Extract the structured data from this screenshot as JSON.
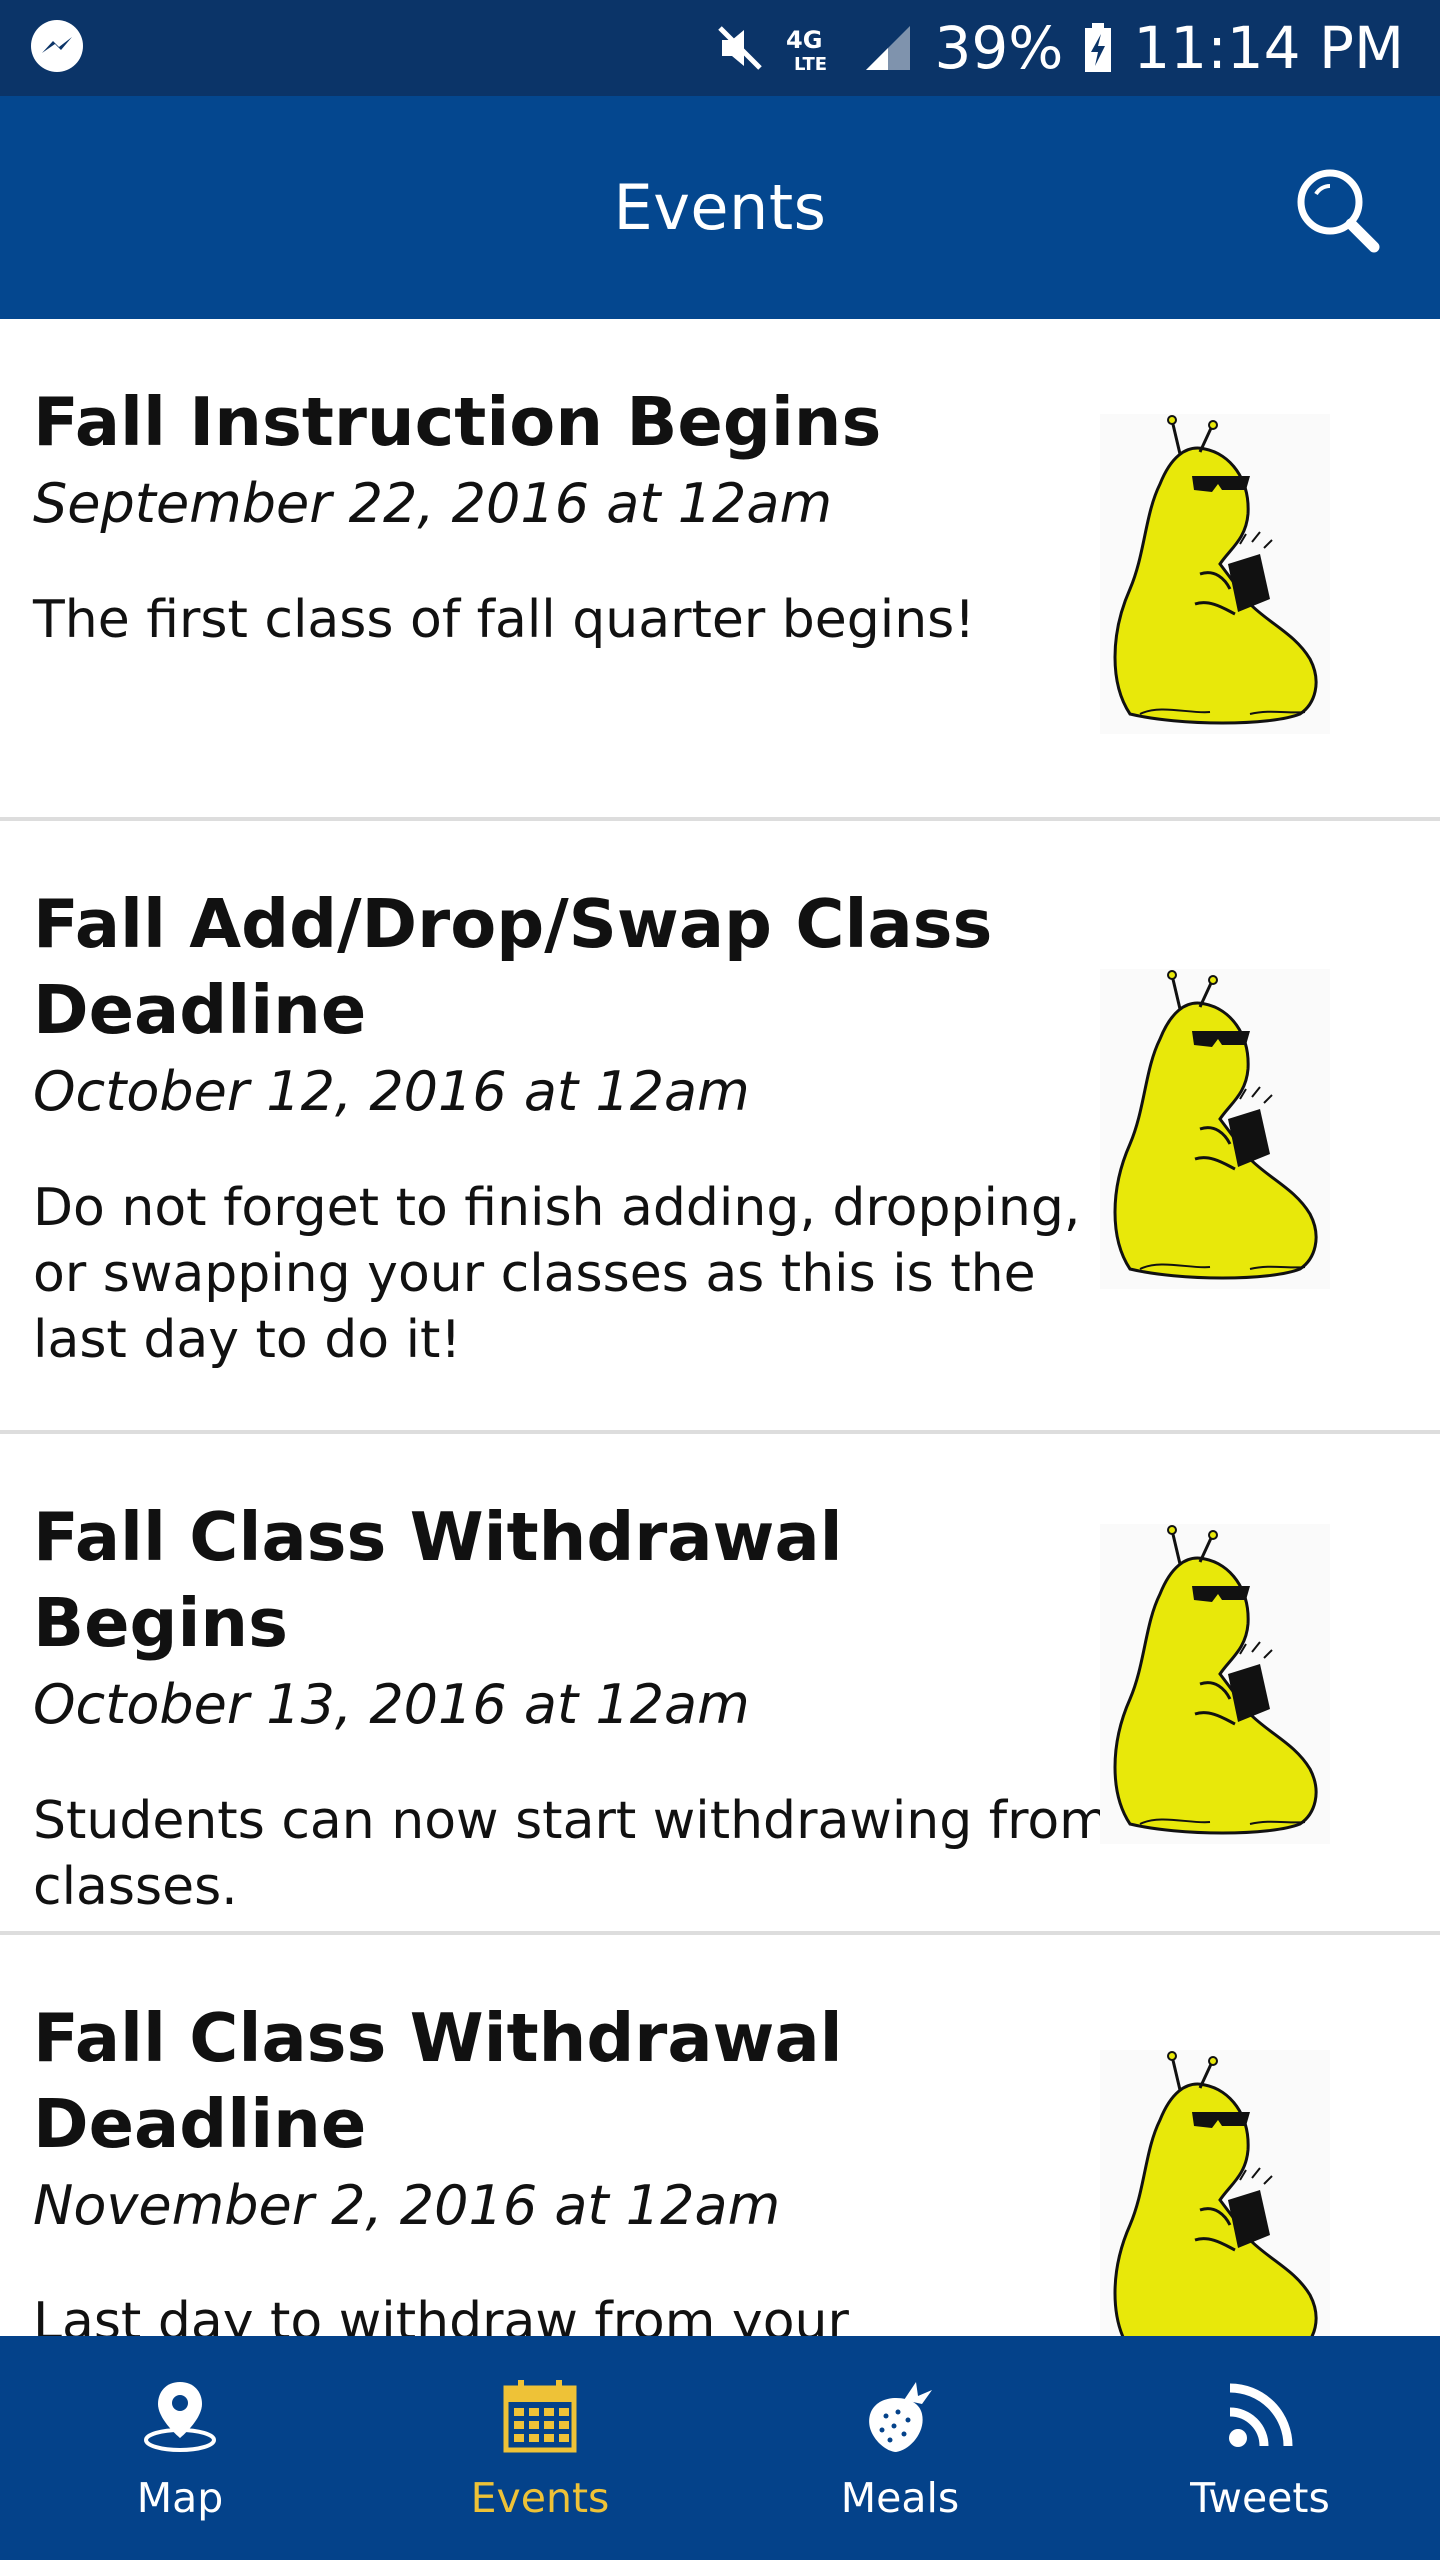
{
  "status_bar": {
    "battery": "39%",
    "time": "11:14 PM",
    "network": "4G LTE"
  },
  "header": {
    "title": "Events"
  },
  "events": [
    {
      "title": "Fall Instruction Begins",
      "date": "September 22, 2016 at 12am",
      "description": "The first class of fall quarter begins!"
    },
    {
      "title": "Fall Add/Drop/Swap Class Deadline",
      "date": "October 12, 2016 at 12am",
      "description": "Do not forget to finish adding, dropping, or swapping your classes as this is the last day to do it!"
    },
    {
      "title": "Fall Class Withdrawal Begins",
      "date": "October 13, 2016 at 12am",
      "description": "Students can now start withdrawing from classes."
    },
    {
      "title": "Fall Class Withdrawal Deadline",
      "date": "November 2, 2016 at 12am",
      "description": "Last day to withdraw from your"
    }
  ],
  "bottom_nav": [
    {
      "label": "Map",
      "icon": "map-pin-icon",
      "active": false
    },
    {
      "label": "Events",
      "icon": "calendar-icon",
      "active": true
    },
    {
      "label": "Meals",
      "icon": "strawberry-icon",
      "active": false
    },
    {
      "label": "Tweets",
      "icon": "rss-icon",
      "active": false
    }
  ],
  "colors": {
    "status_bar": "#0b3468",
    "app_bar": "#04478f",
    "bottom_nav": "#04428a",
    "active_tab": "#eec237",
    "mascot_yellow": "#e8e80a"
  }
}
